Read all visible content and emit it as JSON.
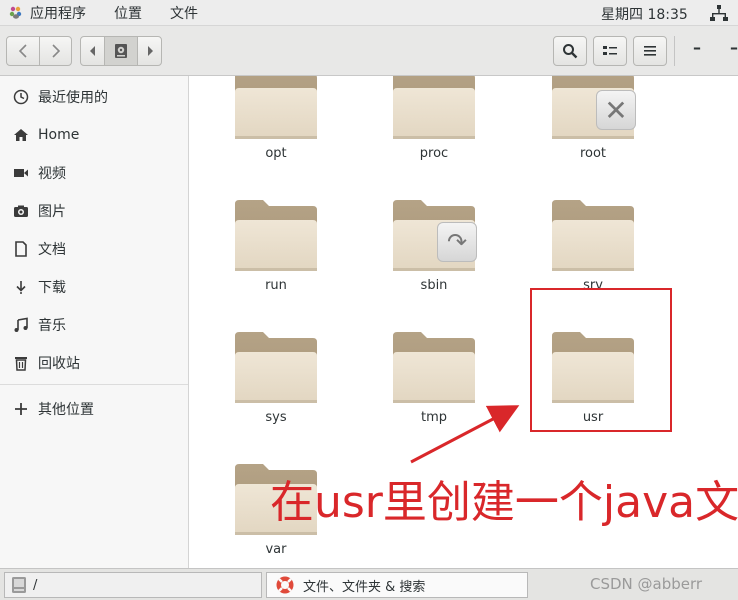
{
  "topbar": {
    "menu_apps": "应用程序",
    "menu_places": "位置",
    "menu_files": "文件",
    "clock": "星期四 18:35",
    "apps_icon": "gnome-foot-icon",
    "network_icon": "network-wired-icon"
  },
  "headerbar": {
    "back_icon": "chevron-left-icon",
    "forward_icon": "chevron-right-icon",
    "path_prev_icon": "chevron-left-icon",
    "path_root_icon": "drive-icon",
    "path_next_icon": "chevron-right-icon",
    "search_icon": "search-icon",
    "view_icon": "list-view-icon",
    "menu_icon": "hamburger-menu-icon",
    "minimize_label": "–",
    "maximize_label": "–"
  },
  "sidebar": {
    "items": [
      {
        "label": "最近使用的",
        "icon": "clock-icon"
      },
      {
        "label": "Home",
        "icon": "home-icon"
      },
      {
        "label": "视频",
        "icon": "video-icon"
      },
      {
        "label": "图片",
        "icon": "camera-icon"
      },
      {
        "label": "文档",
        "icon": "document-icon"
      },
      {
        "label": "下载",
        "icon": "download-icon"
      },
      {
        "label": "音乐",
        "icon": "music-icon"
      },
      {
        "label": "回收站",
        "icon": "trash-icon"
      },
      {
        "label": "其他位置",
        "icon": "plus-icon"
      }
    ]
  },
  "content": {
    "folders": [
      {
        "name": "opt"
      },
      {
        "name": "proc"
      },
      {
        "name": "root",
        "emblem": "unreadable-x-icon"
      },
      {
        "name": "run"
      },
      {
        "name": "sbin",
        "emblem": "symlink-arrow-icon"
      },
      {
        "name": "srv"
      },
      {
        "name": "sys"
      },
      {
        "name": "tmp"
      },
      {
        "name": "usr"
      },
      {
        "name": "var"
      }
    ],
    "annotation": "在usr里创建一个java文件夹",
    "accent": "#d9272a"
  },
  "statusbar": {
    "location": "/",
    "task_label": "文件、文件夹 & 搜索",
    "task_icon": "lifebuoy-icon",
    "watermark": "CSDN @abberr"
  }
}
